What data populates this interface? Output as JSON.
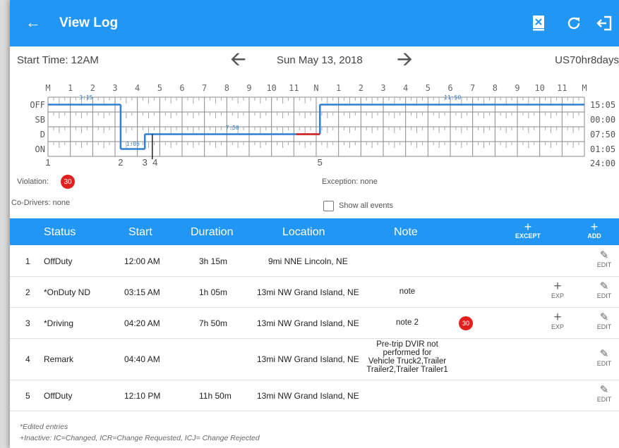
{
  "appbar": {
    "title": "View Log",
    "back_icon": "arrow-left-icon",
    "icons": [
      "close-document-icon",
      "refresh-icon",
      "logout-icon"
    ]
  },
  "header": {
    "start_time": "Start Time: 12AM",
    "date": "Sun May 13, 2018",
    "ruleset": "US70hr8days"
  },
  "graph": {
    "hour_labels": [
      "M",
      "1",
      "2",
      "3",
      "4",
      "5",
      "6",
      "7",
      "8",
      "9",
      "10",
      "11",
      "N",
      "1",
      "2",
      "3",
      "4",
      "5",
      "6",
      "7",
      "8",
      "9",
      "10",
      "11",
      "M"
    ],
    "status_labels": [
      "OFF",
      "SB",
      "D",
      "ON"
    ],
    "totals": [
      "15:05",
      "00:00",
      "07:50",
      "01:05",
      "24:00"
    ],
    "segment_labels": [
      "3:15",
      "1:05",
      "7:50",
      "11:50"
    ],
    "event_numbers": [
      "1",
      "2",
      "3",
      "4",
      "5"
    ]
  },
  "info": {
    "violation_label": "Violation:",
    "violation_badge": "30",
    "exception": "Exception: none",
    "codrivers": "Co-Drivers: none",
    "show_all": "Show all events"
  },
  "table": {
    "headers": {
      "status": "Status",
      "start": "Start",
      "duration": "Duration",
      "location": "Location",
      "note": "Note",
      "except": "EXCEPT",
      "add": "ADD"
    },
    "rows": [
      {
        "num": "1",
        "status": "OffDuty",
        "start": "12:00 AM",
        "duration": "3h 15m",
        "location": "9mi NNE Lincoln, NE",
        "note": "",
        "edit": "EDIT"
      },
      {
        "num": "2",
        "status": "*OnDuty ND",
        "start": "03:15 AM",
        "duration": "1h 05m",
        "location": "13mi NW Grand Island, NE",
        "note": "note",
        "exp": "EXP",
        "edit": "EDIT"
      },
      {
        "num": "3",
        "status": "*Driving",
        "start": "04:20 AM",
        "duration": "7h 50m",
        "location": "13mi NW Grand Island, NE",
        "note": "note 2",
        "badge": "30",
        "exp": "EXP",
        "edit": "EDIT"
      },
      {
        "num": "4",
        "status": "Remark",
        "start": "04:40 AM",
        "duration": "",
        "location": "13mi NW Grand Island, NE",
        "note_lines": [
          "Pre-trip DVIR not",
          "performed for",
          "Vehicle Truck2,Trailer",
          "Trailer2,Trailer Trailer1"
        ],
        "edit": "EDIT"
      },
      {
        "num": "5",
        "status": "OffDuty",
        "start": "12:10 PM",
        "duration": "11h 50m",
        "location": "13mi NW Grand Island, NE",
        "note": "",
        "edit": "EDIT"
      }
    ]
  },
  "footer": {
    "line1": "*Edited entries",
    "line2": "+Inactive: IC=Changed, ICR=Change Requested, ICJ= Change Rejected"
  },
  "colors": {
    "primary": "#2196f3",
    "violation": "#e32020",
    "graph_line": "#2f7fd0"
  }
}
